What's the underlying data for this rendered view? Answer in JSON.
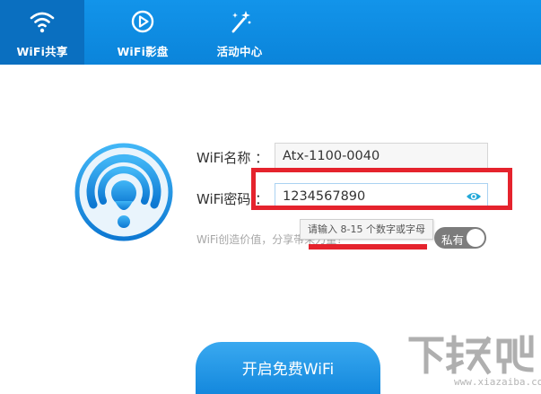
{
  "nav": {
    "tabs": [
      {
        "label": "WiFi共享",
        "icon": "wifi-icon",
        "active": true
      },
      {
        "label": "WiFi影盘",
        "icon": "play-icon",
        "active": false
      },
      {
        "label": "活动中心",
        "icon": "magic-wand-icon",
        "active": false
      }
    ]
  },
  "form": {
    "name_label": "WiFi名称 ：",
    "name_value": "Atx-1100-0040",
    "password_label": "WiFi密码 ：",
    "password_value": "1234567890",
    "password_hint": "请输入 8-15 个数字或字母",
    "share_note": "WiFi创造价值，分享带来力量！",
    "privacy_toggle_label": "私有",
    "privacy_on": false
  },
  "cta": {
    "label": "开启免费WiFi"
  },
  "watermark": {
    "logo": "下载吧",
    "url": "www.xiazaiba.com"
  },
  "colors": {
    "brand_blue": "#0b84da",
    "active_tab": "#0a6fc0",
    "annotation_red": "#e5232d",
    "toggle_off": "#7c7c7c"
  }
}
